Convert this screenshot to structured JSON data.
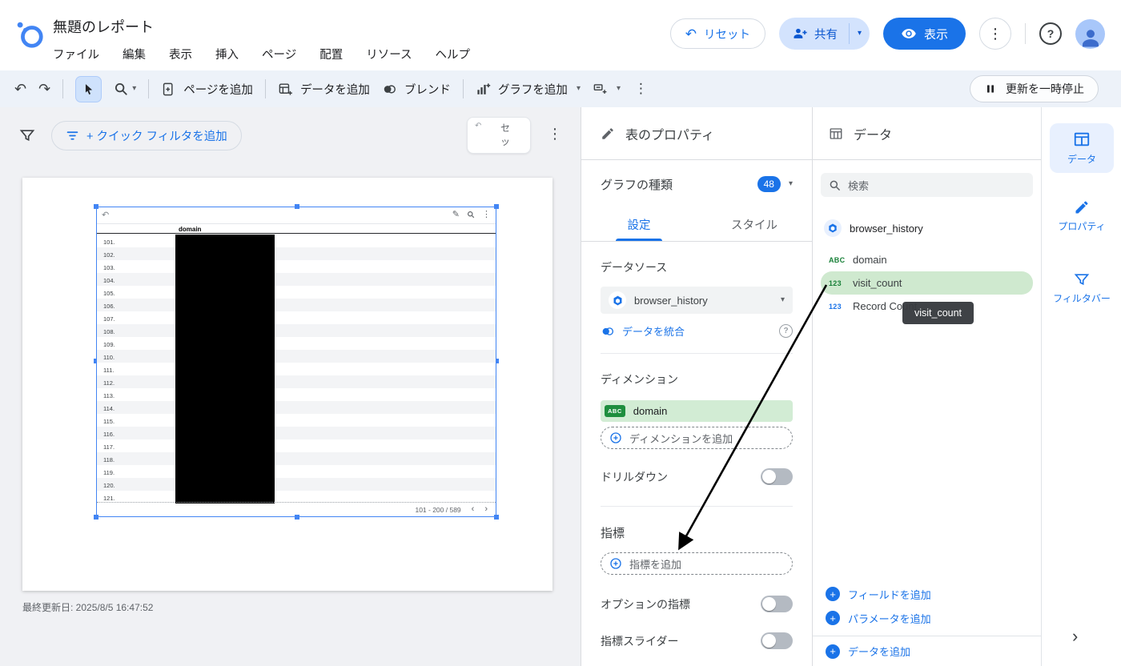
{
  "glyphs": {
    "undo": "↶",
    "redo": "↷",
    "more": "⋮",
    "caret": "▾",
    "prev": "‹",
    "next": "›",
    "help": "?",
    "plus": "+"
  },
  "header": {
    "title": "無題のレポート",
    "menus": [
      "ファイル",
      "編集",
      "表示",
      "挿入",
      "ページ",
      "配置",
      "リソース",
      "ヘルプ"
    ],
    "reset_label": "リセット",
    "share_label": "共有",
    "view_label": "表示"
  },
  "toolbar": {
    "add_page_label": "ページを追加",
    "add_data_label": "データを追加",
    "blend_label": "ブレンド",
    "add_chart_label": "グラフを追加",
    "pause_label": "更新を一時停止"
  },
  "filter_bar": {
    "quick_filter_label": "+ クイック フィルタを追加",
    "partial_chars": [
      "セ",
      "ッ"
    ]
  },
  "canvas": {
    "last_updated": "最終更新日: 2025/8/5 16:47:52",
    "table": {
      "column_header": "domain",
      "row_numbers": [
        "101.",
        "102.",
        "103.",
        "104.",
        "105.",
        "106.",
        "107.",
        "108.",
        "109.",
        "110.",
        "111.",
        "112.",
        "113.",
        "114.",
        "115.",
        "116.",
        "117.",
        "118.",
        "119.",
        "120.",
        "121."
      ],
      "pagination": "101 - 200 / 589"
    }
  },
  "properties_panel": {
    "title": "表のプロパティ",
    "chart_type_label": "グラフの種類",
    "chart_type_count": "48",
    "tab_setup": "設定",
    "tab_style": "スタイル",
    "data_source_label": "データソース",
    "data_source_name": "browser_history",
    "blend_link_label": "データを統合",
    "dimension_label": "ディメンション",
    "dimension_field": {
      "badge": "ABC",
      "name": "domain"
    },
    "add_dimension_label": "ディメンションを追加",
    "drilldown_label": "ドリルダウン",
    "metric_label": "指標",
    "add_metric_label": "指標を追加",
    "optional_metrics_label": "オプションの指標",
    "metric_slider_label": "指標スライダー"
  },
  "data_panel": {
    "title": "データ",
    "search_placeholder": "検索",
    "source_name": "browser_history",
    "fields": [
      {
        "badge": "ABC",
        "name": "domain"
      },
      {
        "badge": "123",
        "name": "visit_count"
      },
      {
        "badge": "123",
        "name": "Record Count"
      }
    ],
    "drag_tooltip": "visit_count",
    "add_field_label": "フィールドを追加",
    "add_parameter_label": "パラメータを追加",
    "add_data_label": "データを追加"
  },
  "right_rail": {
    "data_label": "データ",
    "properties_label": "プロパティ",
    "filter_bar_label": "フィルタバー"
  }
}
